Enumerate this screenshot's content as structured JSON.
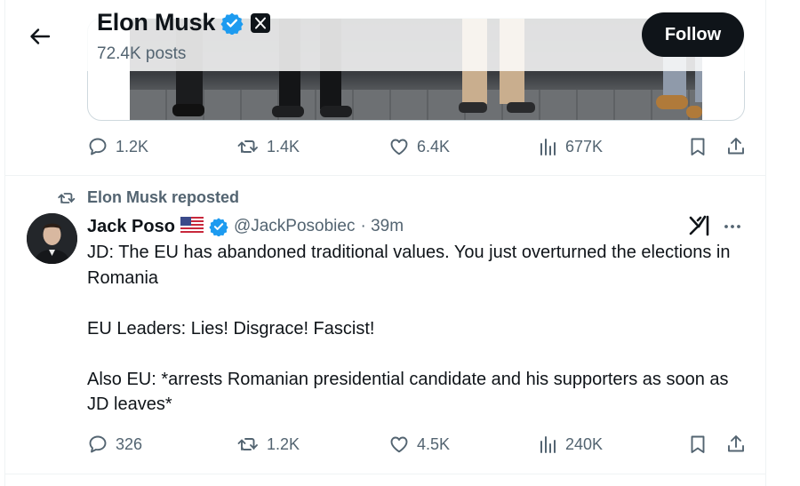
{
  "header": {
    "title": "Elon Musk",
    "posts_count": "72.4K posts",
    "follow_label": "Follow"
  },
  "post1": {
    "stats": {
      "replies": "1.2K",
      "reposts": "1.4K",
      "likes": "6.4K",
      "views": "677K"
    }
  },
  "post2": {
    "repost_label": "Elon Musk reposted",
    "author": {
      "name": "Jack Poso",
      "handle": "@JackPosobiec",
      "time": "· 39m"
    },
    "text": "JD: The EU has abandoned traditional values. You just overturned the elections in Romania\n\nEU Leaders: Lies! Disgrace! Fascist!\n\nAlso EU: *arrests Romanian presidential candidate and his supporters as soon as JD leaves*",
    "stats": {
      "replies": "326",
      "reposts": "1.2K",
      "likes": "4.5K",
      "views": "240K"
    }
  },
  "colors": {
    "verified": "#1d9bf0",
    "text_primary": "#0f1419",
    "text_secondary": "#536471",
    "button": "#0f1419"
  },
  "icons": [
    "back-arrow-icon",
    "verified-badge-icon",
    "x-logo-icon",
    "reply-icon",
    "repost-icon",
    "like-icon",
    "views-icon",
    "bookmark-icon",
    "share-icon",
    "grok-icon",
    "more-icon",
    "us-flag-icon"
  ]
}
